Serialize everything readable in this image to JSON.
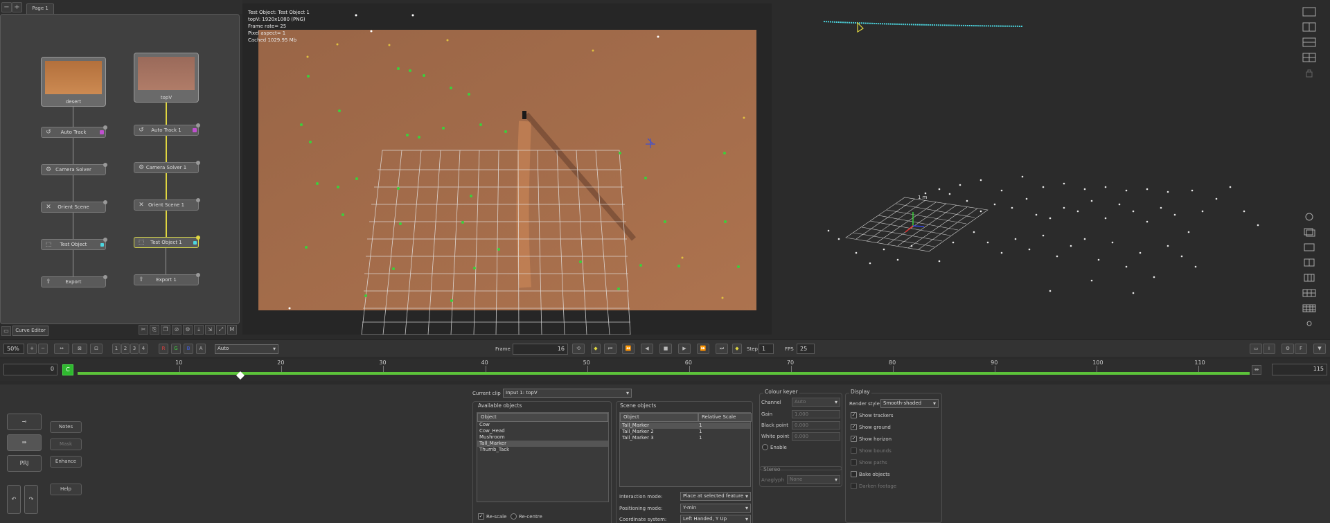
{
  "tabs": {
    "page1": "Page 1"
  },
  "nodes": {
    "left": {
      "source": "desert",
      "track": "Auto Track",
      "solver": "Camera Solver",
      "orient": "Orient Scene",
      "test": "Test Object",
      "export": "Export"
    },
    "right": {
      "source": "topV",
      "track": "Auto Track 1",
      "solver": "Camera Solver 1",
      "orient": "Orient Scene 1",
      "test": "Test Object 1",
      "export": "Export 1"
    }
  },
  "curve_editor": "Curve Editor",
  "viewer_info": [
    "Test Object: Test Object 1",
    "topV: 1920x1080 (PNG)",
    "Frame rate= 25",
    "Pixel aspect= 1",
    "Cached 1029.95 Mb"
  ],
  "scale_label": "1 m",
  "transport": {
    "zoom": "50%",
    "channels": [
      "1",
      "2",
      "3",
      "4"
    ],
    "rgb": [
      "R",
      "G",
      "B",
      "A"
    ],
    "mode": "Auto",
    "frame_label": "Frame",
    "frame_value": "16",
    "step_label": "Step",
    "step_value": "1",
    "fps_label": "FPS",
    "fps_value": "25"
  },
  "timeline": {
    "start": "0",
    "end": "115",
    "ticks": [
      "10",
      "20",
      "30",
      "40",
      "50",
      "60",
      "70",
      "80",
      "90",
      "100",
      "110"
    ],
    "key_badge": "C",
    "current_frame": 16,
    "last_frame": 115
  },
  "left_buttons": {
    "notes": "Notes",
    "mask": "Mask",
    "enhance": "Enhance",
    "help": "Help",
    "prj": "PRJ"
  },
  "clip": {
    "label": "Current clip",
    "value": "Input 1: topV"
  },
  "available": {
    "title": "Available objects",
    "header": "Object",
    "items": [
      "Cow",
      "Cow_Head",
      "Mushroom",
      "Tall_Marker",
      "Thumb_Tack"
    ]
  },
  "scene": {
    "title": "Scene objects",
    "header_obj": "Object",
    "header_scale": "Relative Scale",
    "rows": [
      {
        "name": "Tall_Marker",
        "scale": "1"
      },
      {
        "name": "Tall_Marker 2",
        "scale": "1"
      },
      {
        "name": "Tall_Marker 3",
        "scale": "1"
      }
    ]
  },
  "rescale": "Re-scale",
  "recentre": "Re-centre",
  "interaction": {
    "label": "Interaction mode:",
    "value": "Place at selected feature"
  },
  "positioning": {
    "label": "Positioning mode:",
    "value": "Y-min"
  },
  "coords": {
    "label": "Coordinate system:",
    "value": "Left Handed, Y Up"
  },
  "keyer": {
    "title": "Colour keyer",
    "channel_label": "Channel",
    "channel": "Auto",
    "gain_label": "Gain",
    "gain": "1.000",
    "black_label": "Black point",
    "black": "0.000",
    "white_label": "White point",
    "white": "0.000",
    "enable": "Enable"
  },
  "stereo": {
    "title": "Stereo",
    "anaglyph_label": "Anaglyph",
    "anaglyph": "None"
  },
  "display": {
    "title": "Display",
    "render_label": "Render style",
    "render": "Smooth-shaded",
    "options": [
      {
        "label": "Show trackers",
        "checked": true,
        "enabled": true
      },
      {
        "label": "Show ground",
        "checked": true,
        "enabled": true
      },
      {
        "label": "Show horizon",
        "checked": true,
        "enabled": true
      },
      {
        "label": "Show bounds",
        "checked": false,
        "enabled": false
      },
      {
        "label": "Show paths",
        "checked": false,
        "enabled": false
      },
      {
        "label": "Bake objects",
        "checked": false,
        "enabled": true
      },
      {
        "label": "Darken footage",
        "checked": false,
        "enabled": false
      }
    ]
  },
  "colors": {
    "accent_green": "#5cc23a",
    "track_yellow": "#e0d640",
    "tracker_green": "#3ccf3c",
    "trail_cyan": "#4cd6e0"
  }
}
